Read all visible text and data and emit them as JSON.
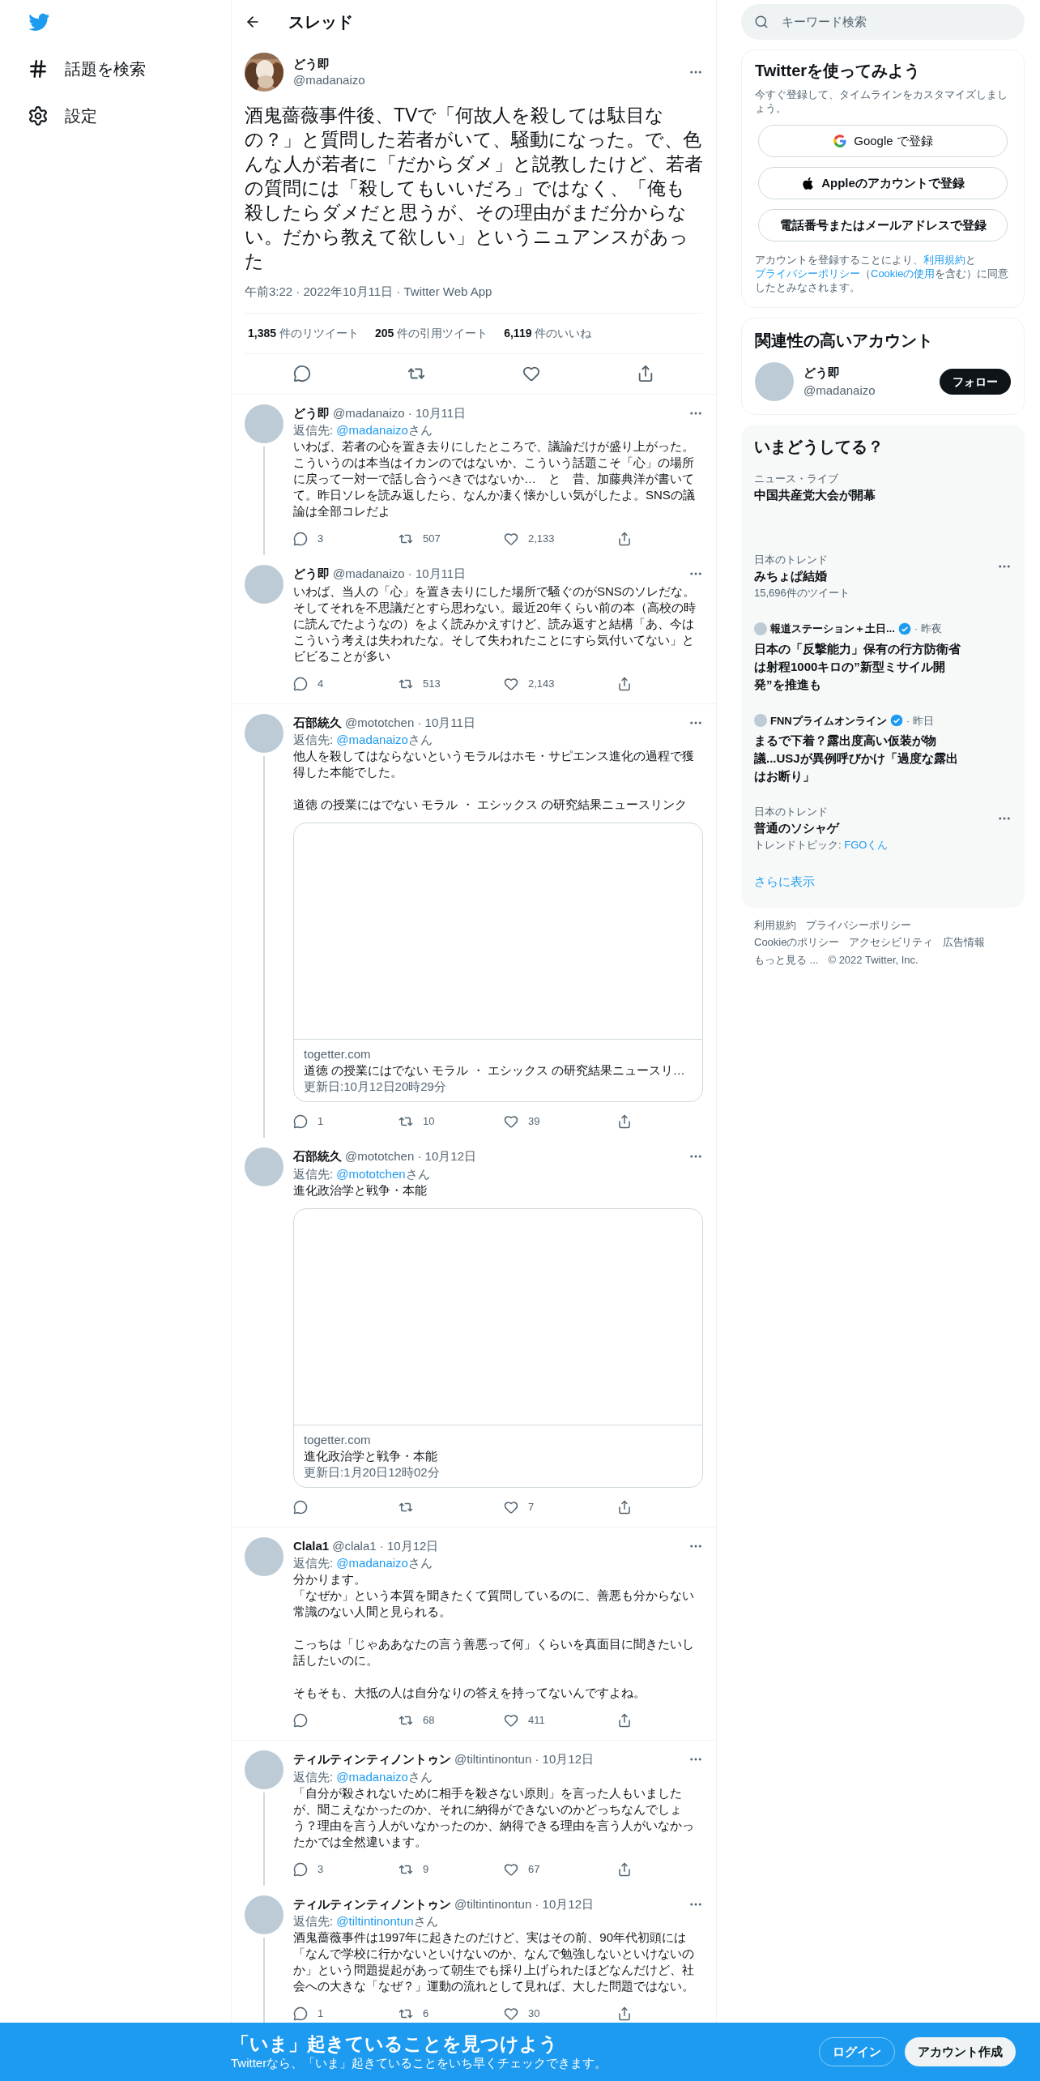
{
  "nav": {
    "items": [
      {
        "label": "話題を検索"
      },
      {
        "label": "設定"
      }
    ]
  },
  "header": {
    "title": "スレッド"
  },
  "main_tweet": {
    "name": "どう即",
    "handle": "@madanaizo",
    "text": "酒鬼薔薇事件後、TVで「何故人を殺しては駄目なの？」と質問した若者がいて、騒動になった。で、色んな人が若者に「だからダメ」と説教したけど、若者の質問には「殺してもいいだろ」ではなく、「俺も殺したらダメだと思うが、その理由がまだ分からない。だから教えて欲しい」というニュアンスがあった",
    "meta": "午前3:22 · 2022年10月11日 · Twitter Web App",
    "stats": [
      {
        "count": "1,385",
        "label": "件のリツイート"
      },
      {
        "count": "205",
        "label": "件の引用ツイート"
      },
      {
        "count": "6,119",
        "label": "件のいいね"
      }
    ]
  },
  "replies": [
    {
      "name": "どう即",
      "meta": "@madanaizo · 10月11日",
      "reply_to": {
        "prefix": "返信先: ",
        "handle": "@madanaizo",
        "suffix": "さん"
      },
      "paragraphs": [
        [
          "いわば、若者の心を置き去りにしたところで、議論だけが盛り上がった。こういうのは本当はイカンのではないか、こういう話題こそ「心」の場所に戻って一対一で話し合うべきではないか…　と　昔、加藤典洋が書いてて。昨日ソレを読み返したら、なんか凄く懐かしい気がしたよ。SNSの議論は全部コレだよ"
        ]
      ],
      "replies": "3",
      "retweets": "507",
      "likes": "2,133",
      "connects_next": true
    },
    {
      "name": "どう即",
      "meta": "@madanaizo · 10月11日",
      "paragraphs": [
        [
          "いわば、当人の「心」を置き去りにした場所で騒ぐのがSNSのソレだな。そしてそれを不思議だとすら思わない。最近20年くらい前の本（高校の時に読んでたようなの）をよく読みかえすけど、読み返すと結構「あ、今はこういう考えは失われたな。そして失われたことにすら気付いてない」とビビることが多い"
        ]
      ],
      "replies": "4",
      "retweets": "513",
      "likes": "2,143",
      "connects_next": false
    },
    {
      "name": "石部統久",
      "meta": "@mototchen · 10月11日",
      "reply_to": {
        "prefix": "返信先: ",
        "handle": "@madanaizo",
        "suffix": "さん"
      },
      "paragraphs": [
        [
          "他人を殺してはならないというモラルはホモ・サピエンス進化の過程で獲得した本能でした。"
        ],
        [
          "道徳 の授業にはでない モラル ・ エシックス の研究結果ニュースリンク"
        ]
      ],
      "card": {
        "domain": "togetter.com",
        "title": "道徳 の授業にはでない モラル ・ エシックス の研究結果ニュースリ…",
        "updated": "更新日:10月12日20時29分"
      },
      "replies": "1",
      "retweets": "10",
      "likes": "39",
      "connects_next": true
    },
    {
      "name": "石部統久",
      "meta": "@mototchen · 10月12日",
      "reply_to": {
        "prefix": "返信先: ",
        "handle": "@mototchen",
        "suffix": "さん"
      },
      "paragraphs": [
        [
          "進化政治学と戦争・本能"
        ]
      ],
      "card": {
        "domain": "togetter.com",
        "title": "進化政治学と戦争・本能",
        "updated": "更新日:1月20日12時02分"
      },
      "likes": "7",
      "connects_next": false
    },
    {
      "name": "Clala1",
      "meta": "@clala1 · 10月12日",
      "reply_to": {
        "prefix": "返信先: ",
        "handle": "@madanaizo",
        "suffix": "さん"
      },
      "paragraphs": [
        [
          "分かります。",
          "「なぜか」という本質を聞きたくて質問しているのに、善悪も分からない常識のない人間と見られる。"
        ],
        [
          "こっちは「じゃああなたの言う善悪って何」くらいを真面目に聞きたいし話したいのに。"
        ],
        [
          "そもそも、大抵の人は自分なりの答えを持ってないんですよね。"
        ]
      ],
      "retweets": "68",
      "likes": "411",
      "connects_next": false
    },
    {
      "name": "ティルティンティノントゥン",
      "meta": "@tiltintinontun · 10月12日",
      "reply_to": {
        "prefix": "返信先: ",
        "handle": "@madanaizo",
        "suffix": "さん"
      },
      "paragraphs": [
        [
          "「自分が殺されないために相手を殺さない原則」を言った人もいましたが、聞こえなかったのか、それに納得ができないのかどっちなんでしょう？理由を言う人がいなかったのか、納得できる理由を言う人がいなかったかでは全然違います。"
        ]
      ],
      "replies": "3",
      "retweets": "9",
      "likes": "67",
      "connects_next": true
    },
    {
      "name": "ティルティンティノントゥン",
      "meta": "@tiltintinontun · 10月12日",
      "reply_to": {
        "prefix": "返信先: ",
        "handle": "@tiltintinontun",
        "suffix": "さん"
      },
      "paragraphs": [
        [
          "酒鬼薔薇事件は1997年に起きたのだけど、実はその前、90年代初頭には「なんで学校に行かないといけないのか、なんで勉強しないといけないのか」という問題提起があって朝生でも採り上げられたほどなんだけど、社会への大きな「なぜ？」運動の流れとして見れば、大した問題ではない。"
        ]
      ],
      "replies": "1",
      "retweets": "6",
      "likes": "30",
      "connects_next": true
    }
  ],
  "sidebar": {
    "search": {
      "placeholder": "キーワード検索"
    },
    "signup": {
      "title": "Twitterを使ってみよう",
      "subtitle": "今すぐ登録して、タイムラインをカスタマイズしましょう。",
      "buttons": [
        {
          "kind": "google",
          "label": "Google で登録"
        },
        {
          "kind": "apple",
          "label": "Appleのアカウントで登録"
        },
        {
          "kind": "plain",
          "label": "電話番号またはメールアドレスで登録"
        }
      ],
      "legal": [
        {
          "text": "アカウントを登録することにより、",
          "link": false
        },
        {
          "text": "利用規約",
          "link": true
        },
        {
          "text": "と",
          "link": false
        },
        {
          "text": "プライバシーポリシー",
          "link": true
        },
        {
          "text": "（",
          "link": false
        },
        {
          "text": "Cookieの使用",
          "link": true
        },
        {
          "text": "を含む）に同意したとみなされます。",
          "link": false
        }
      ]
    },
    "related": {
      "title": "関連性の高いアカウント",
      "name": "どう即",
      "handle": "@madanaizo",
      "button": "フォロー"
    },
    "trends": {
      "title": "いまどうしてる？",
      "items": [
        {
          "kind": "trend",
          "category": "ニュース・ライブ",
          "title": "中国共産党大会が開幕",
          "menu": false
        },
        {
          "kind": "trend",
          "category": "日本のトレンド",
          "title": "みちょぱ結婚",
          "count": "15,696件のツイート",
          "menu": true
        },
        {
          "kind": "news",
          "source": "報道ステーション＋土日...",
          "verified": true,
          "time": "· 昨夜",
          "title": "日本の「反撃能力」保有の行方防衛省は射程1000キロの”新型ミサイル開発”を推進も"
        },
        {
          "kind": "news",
          "source": "FNNプライムオンライン",
          "verified": true,
          "time": "· 昨日",
          "title": "まるで下着？露出度高い仮装が物議...USJが異例呼びかけ「過度な露出はお断り」"
        },
        {
          "kind": "trend",
          "category": "日本のトレンド",
          "title": "普通のソシャゲ",
          "topic": {
            "prefix": "トレンドトピック: ",
            "link": "FGOくん"
          },
          "menu": true
        }
      ],
      "more": "さらに表示"
    },
    "footer": [
      "利用規約",
      "プライバシーポリシー",
      "Cookieのポリシー",
      "アクセシビリティ",
      "広告情報",
      "もっと見る ...",
      "© 2022 Twitter, Inc."
    ]
  },
  "banner": {
    "title": "「いま」起きていることを見つけよう",
    "subtitle": "Twitterなら、「いま」起きていることをいち早くチェックできます。",
    "login": "ログイン",
    "signup": "アカウント作成"
  }
}
